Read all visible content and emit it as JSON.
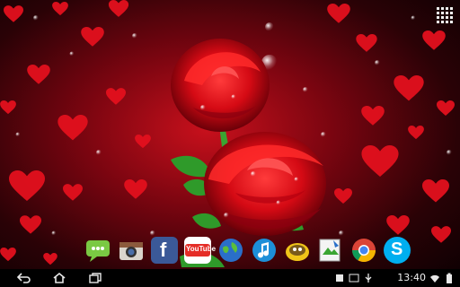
{
  "wallpaper": {
    "subject": "red roses with hearts and water drops",
    "accent": "#d8101c"
  },
  "home": {
    "app_drawer_icon": "grid-icon"
  },
  "dock": {
    "apps": [
      {
        "name": "Messaging",
        "icon": "messaging-icon"
      },
      {
        "name": "Camera",
        "icon": "camera-icon"
      },
      {
        "name": "Facebook",
        "icon": "facebook-icon",
        "glyph": "f"
      },
      {
        "name": "YouTube",
        "icon": "youtube-icon",
        "label": "YouTube"
      },
      {
        "name": "Browser",
        "icon": "globe-icon"
      },
      {
        "name": "Music",
        "icon": "music-icon"
      },
      {
        "name": "Notes",
        "icon": "notes-icon"
      },
      {
        "name": "Gallery",
        "icon": "gallery-icon"
      },
      {
        "name": "Chrome",
        "icon": "chrome-icon"
      },
      {
        "name": "Skype",
        "icon": "skype-icon",
        "glyph": "S"
      }
    ]
  },
  "status_bar": {
    "time": "13:40",
    "tray_icons": [
      "notification-icon",
      "screenshot-icon",
      "usb-icon",
      "wifi-icon",
      "battery-icon"
    ]
  }
}
